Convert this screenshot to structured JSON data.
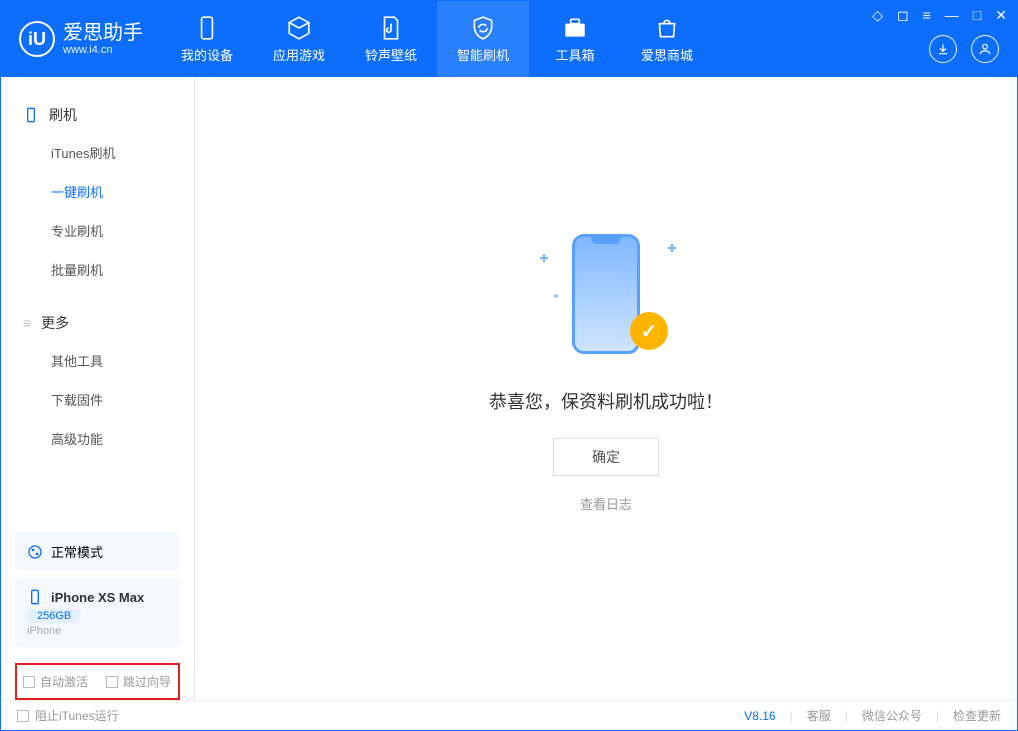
{
  "app": {
    "title": "爱思助手",
    "subtitle": "www.i4.cn"
  },
  "tabs": [
    {
      "label": "我的设备"
    },
    {
      "label": "应用游戏"
    },
    {
      "label": "铃声壁纸"
    },
    {
      "label": "智能刷机"
    },
    {
      "label": "工具箱"
    },
    {
      "label": "爱思商城"
    }
  ],
  "sidebar": {
    "section1_title": "刷机",
    "items1": [
      "iTunes刷机",
      "一键刷机",
      "专业刷机",
      "批量刷机"
    ],
    "section2_title": "更多",
    "items2": [
      "其他工具",
      "下载固件",
      "高级功能"
    ]
  },
  "mode_card": "正常模式",
  "device": {
    "name": "iPhone XS Max",
    "storage": "256GB",
    "type": "iPhone"
  },
  "checkboxes": {
    "auto_activate": "自动激活",
    "skip_guide": "跳过向导"
  },
  "main": {
    "message": "恭喜您，保资料刷机成功啦！",
    "ok": "确定",
    "view_log": "查看日志"
  },
  "footer": {
    "block_itunes": "阻止iTunes运行",
    "version": "V8.16",
    "support": "客服",
    "wechat": "微信公众号",
    "check_update": "检查更新"
  }
}
